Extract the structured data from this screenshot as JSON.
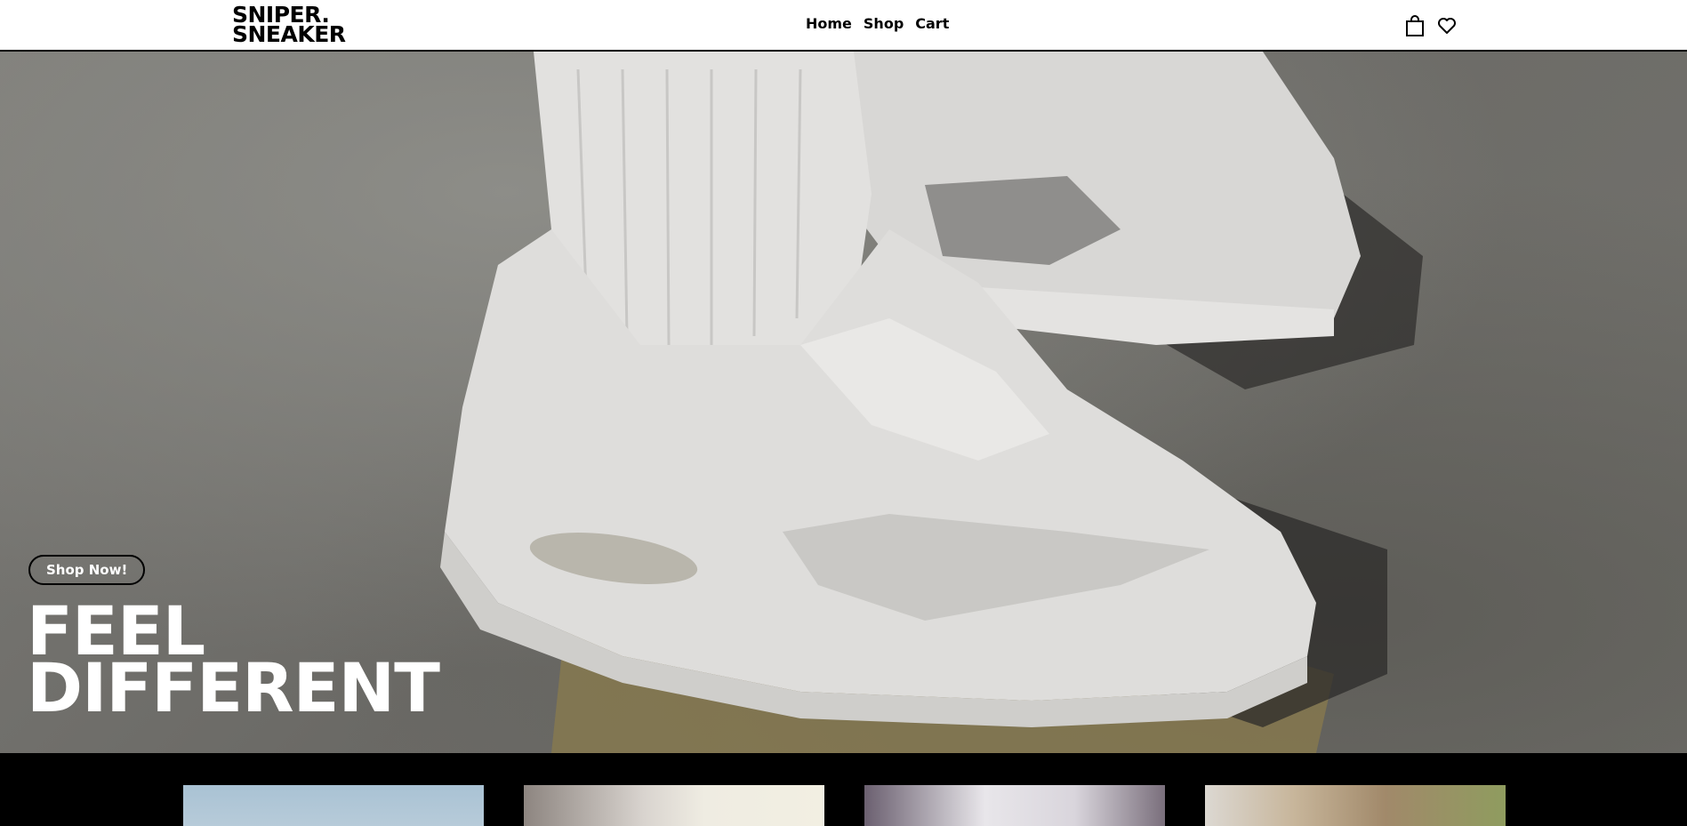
{
  "header": {
    "logo_line1": "SNIPER.",
    "logo_line2": "SNEAKER",
    "nav": [
      "Home",
      "Shop",
      "Cart"
    ],
    "icons": [
      "shopping-bag-icon",
      "heart-icon"
    ]
  },
  "hero": {
    "cta_label": "Shop Now!",
    "headline_line1": "FEEL",
    "headline_line2": "DIFFERENT"
  },
  "products": [
    {
      "name": "product-card-1"
    },
    {
      "name": "product-card-2"
    },
    {
      "name": "product-card-3"
    },
    {
      "name": "product-card-4"
    }
  ],
  "colors": {
    "header_bg": "#ffffff",
    "text": "#000000",
    "hero_text": "#ffffff",
    "strip_bg": "#000000"
  }
}
